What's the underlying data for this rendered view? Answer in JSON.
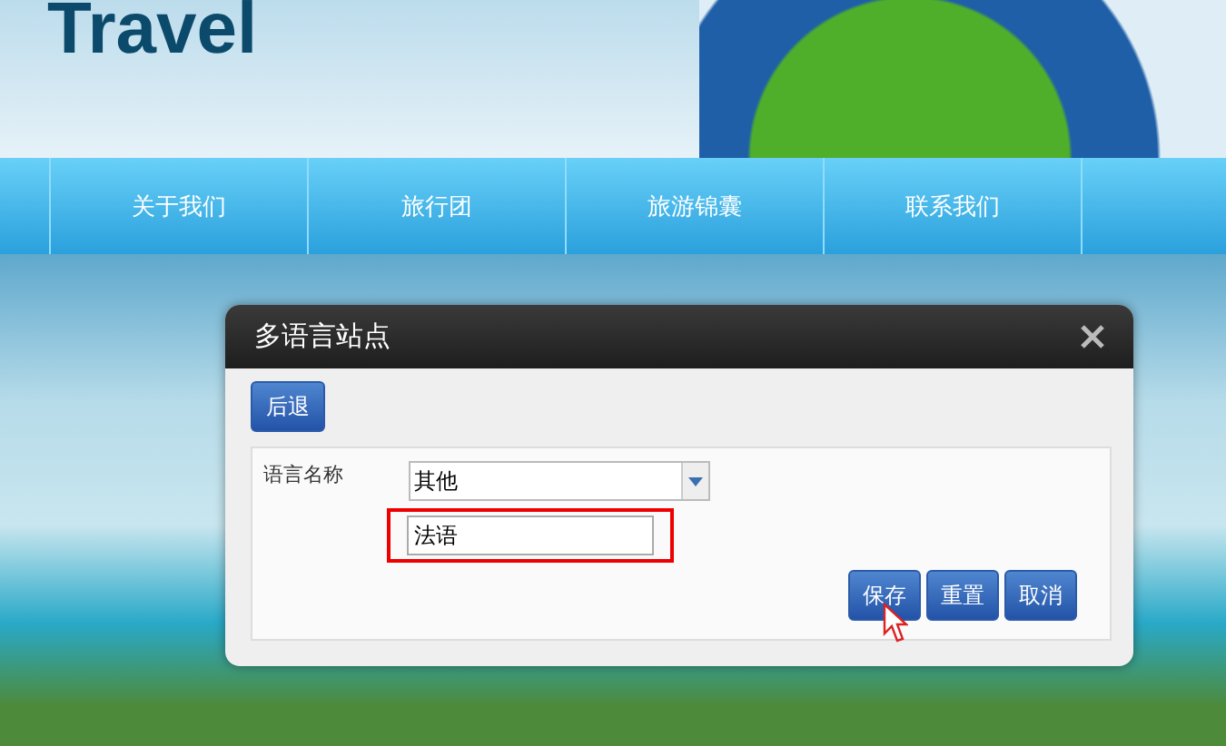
{
  "header": {
    "logo": "Travel"
  },
  "nav": {
    "items": [
      {
        "label": "关于我们"
      },
      {
        "label": "旅行团"
      },
      {
        "label": "旅游锦囊"
      },
      {
        "label": "联系我们"
      }
    ]
  },
  "dialog": {
    "title": "多语言站点",
    "back_button": "后退",
    "form": {
      "label": "语言名称",
      "select_value": "其他",
      "input_value": "法语",
      "input_highlighted": true
    },
    "buttons": [
      {
        "label": "保存"
      },
      {
        "label": "重置"
      },
      {
        "label": "取消"
      }
    ]
  }
}
